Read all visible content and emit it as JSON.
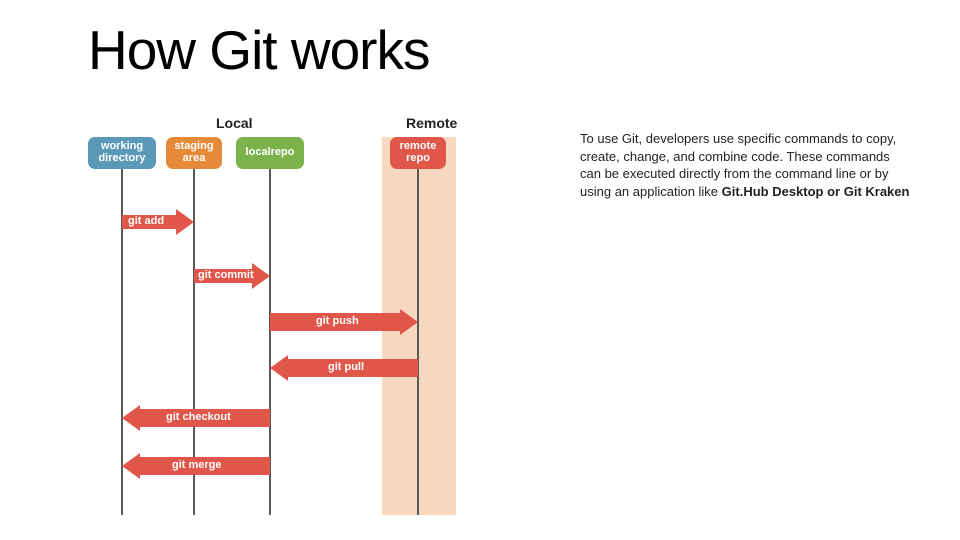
{
  "title": "How Git works",
  "sections": {
    "local": "Local",
    "remote": "Remote"
  },
  "pills": {
    "working_directory": "working directory",
    "staging_area": "staging area",
    "local_repo": "localrepo",
    "remote_repo": "remote repo"
  },
  "commands": {
    "add": "git add",
    "commit": "git commit",
    "push": "git push",
    "pull": "git pull",
    "checkout": "git checkout",
    "merge": "git merge"
  },
  "description": {
    "pre": "To use Git, developers use specific commands to copy, create, change, and combine code. These commands can be executed directly from the command line or by using an application like ",
    "bold": "Git.Hub Desktop or Git Kraken"
  },
  "chart_data": {
    "type": "diagram",
    "title": "How Git works",
    "swimlanes": [
      {
        "group": "Local",
        "lanes": [
          "working directory",
          "staging area",
          "localrepo"
        ]
      },
      {
        "group": "Remote",
        "lanes": [
          "remote repo"
        ]
      }
    ],
    "arrows": [
      {
        "label": "git add",
        "from": "working directory",
        "to": "staging area",
        "direction": "right"
      },
      {
        "label": "git commit",
        "from": "staging area",
        "to": "localrepo",
        "direction": "right"
      },
      {
        "label": "git push",
        "from": "localrepo",
        "to": "remote repo",
        "direction": "right"
      },
      {
        "label": "git pull",
        "from": "remote repo",
        "to": "localrepo",
        "direction": "left"
      },
      {
        "label": "git checkout",
        "from": "localrepo",
        "to": "working directory",
        "direction": "left"
      },
      {
        "label": "git merge",
        "from": "localrepo",
        "to": "working directory",
        "direction": "left"
      }
    ],
    "colors": {
      "working_directory": "#5a9ab8",
      "staging_area": "#e58a39",
      "localrepo": "#7bb24b",
      "remote_repo": "#e0574a",
      "arrow": "#e0574a",
      "remote_bg": "#f8d9c0"
    }
  }
}
